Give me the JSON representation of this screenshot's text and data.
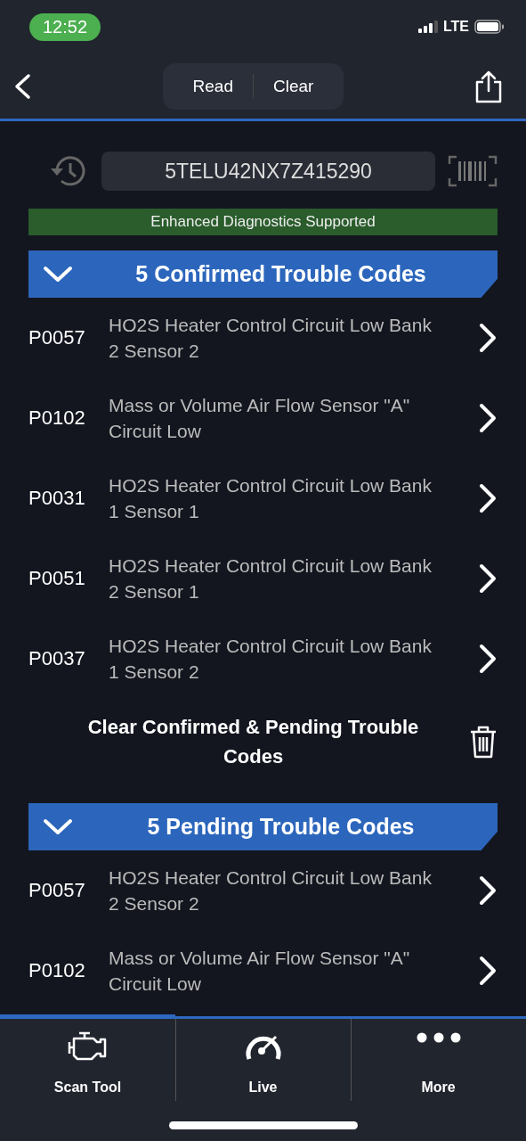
{
  "status_bar": {
    "time": "12:52",
    "network": "LTE"
  },
  "nav": {
    "segments": [
      {
        "label": "Read"
      },
      {
        "label": "Clear"
      }
    ]
  },
  "vin": {
    "value": "5TELU42NX7Z415290"
  },
  "banner": "Enhanced Diagnostics Supported",
  "sections": [
    {
      "title": "5 Confirmed Trouble Codes",
      "expanded": true,
      "codes": [
        {
          "code": "P0057",
          "description": "HO2S Heater Control Circuit Low Bank 2 Sensor 2"
        },
        {
          "code": "P0102",
          "description": "Mass or Volume Air Flow Sensor \"A\" Circuit Low"
        },
        {
          "code": "P0031",
          "description": "HO2S Heater Control Circuit Low Bank 1 Sensor 1"
        },
        {
          "code": "P0051",
          "description": "HO2S Heater Control Circuit Low Bank 2 Sensor 1"
        },
        {
          "code": "P0037",
          "description": "HO2S Heater Control Circuit Low Bank 1 Sensor 2"
        }
      ],
      "action": "Clear Confirmed & Pending Trouble Codes"
    },
    {
      "title": "5 Pending Trouble Codes",
      "expanded": true,
      "codes": [
        {
          "code": "P0057",
          "description": "HO2S Heater Control Circuit Low Bank 2 Sensor 2"
        },
        {
          "code": "P0102",
          "description": "Mass or Volume Air Flow Sensor \"A\" Circuit Low"
        }
      ]
    }
  ],
  "tabs": [
    {
      "label": "Scan Tool",
      "kind": "engine",
      "selected": true
    },
    {
      "label": "Live",
      "kind": "gauge",
      "selected": false
    },
    {
      "label": "More",
      "kind": "dots",
      "selected": false
    }
  ]
}
